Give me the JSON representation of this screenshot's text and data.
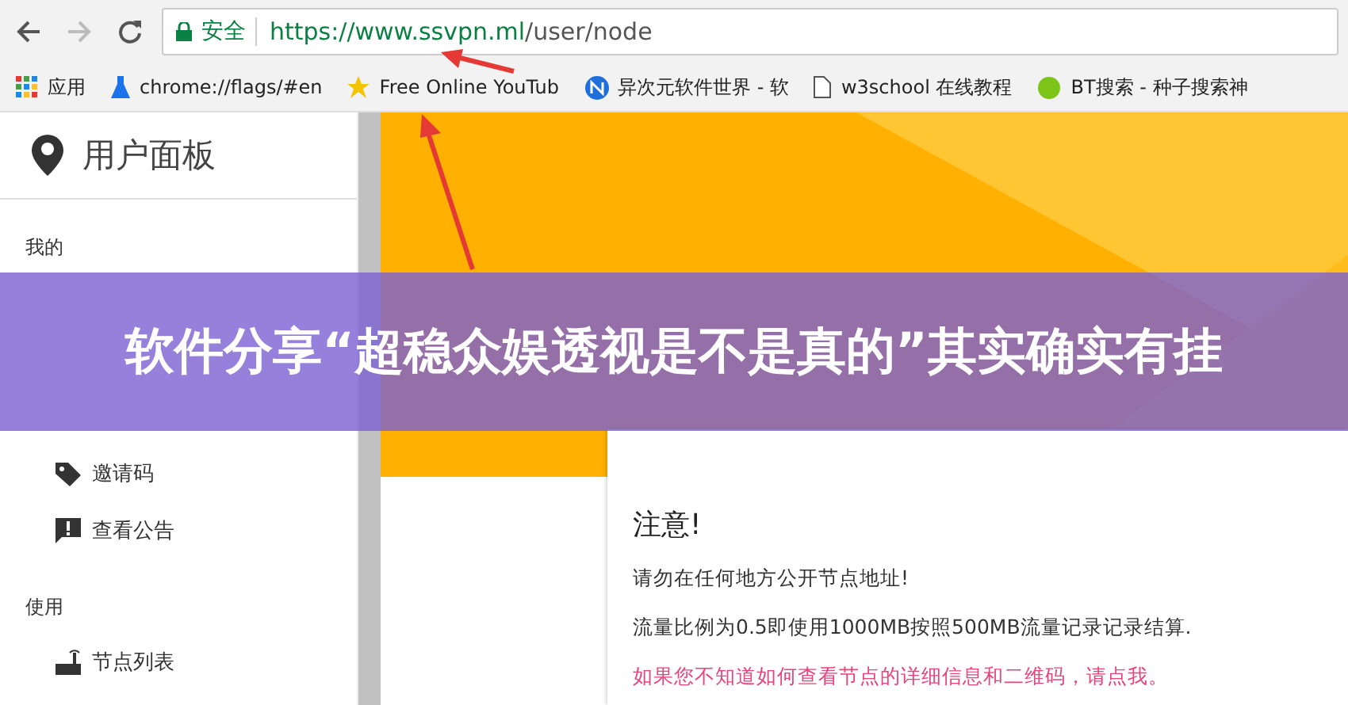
{
  "browser": {
    "secure_label": "安全",
    "url_host": "https://www.ssvpn.ml",
    "url_path": "/user/node"
  },
  "bookmarks": [
    {
      "kind": "apps",
      "label": "应用"
    },
    {
      "kind": "flask",
      "label": "chrome://flags/#en"
    },
    {
      "kind": "star",
      "label": "Free Online YouTub"
    },
    {
      "kind": "badge",
      "label": "异次元软件世界 - 软"
    },
    {
      "kind": "page",
      "label": "w3school 在线教程"
    },
    {
      "kind": "ball",
      "label": "BT搜索 - 种子搜索神"
    }
  ],
  "sidebar": {
    "title": "用户面板",
    "sections": [
      {
        "heading": "我的",
        "items": [
          {
            "kind": "tag",
            "label": "邀请码"
          },
          {
            "kind": "notice",
            "label": "查看公告"
          }
        ]
      },
      {
        "heading": "使用",
        "items": [
          {
            "kind": "router",
            "label": "节点列表"
          }
        ]
      }
    ]
  },
  "notice": {
    "title": "注意!",
    "lines": [
      {
        "kind": "plain",
        "text": "请勿在任何地方公开节点地址!"
      },
      {
        "kind": "plain",
        "text": "流量比例为0.5即使用1000MB按照500MB流量记录记录结算."
      },
      {
        "kind": "link",
        "text": "如果您不知道如何查看节点的详细信息和二维码，请点我。"
      }
    ]
  },
  "banner": {
    "title": "软件分享“超稳众娱透视是不是真的”其实确实有挂"
  }
}
